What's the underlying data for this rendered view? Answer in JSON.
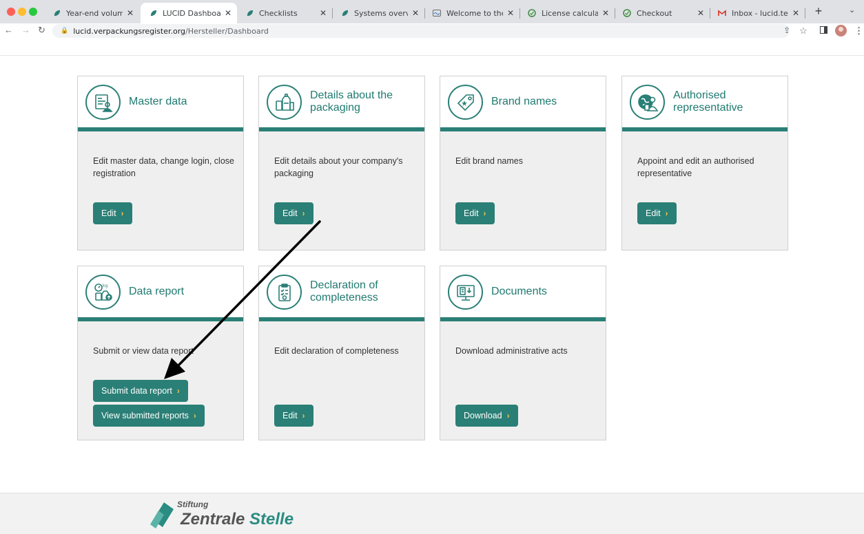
{
  "browser": {
    "tabs": [
      {
        "title": "Year-end volume repo",
        "favicon": "lucid-leaf-icon",
        "active": false
      },
      {
        "title": "LUCID Dashboard",
        "favicon": "lucid-leaf-icon",
        "active": true
      },
      {
        "title": "Checklists",
        "favicon": "lucid-leaf-icon",
        "active": false
      },
      {
        "title": "Systems overview",
        "favicon": "lucid-leaf-icon",
        "active": false
      },
      {
        "title": "Welcome to the Bella",
        "favicon": "wave-icon",
        "active": false
      },
      {
        "title": "License calculator",
        "favicon": "green-circle-icon",
        "active": false
      },
      {
        "title": "Checkout",
        "favicon": "green-circle-icon",
        "active": false
      },
      {
        "title": "Inbox - lucid.test.co@",
        "favicon": "gmail-icon",
        "active": false
      }
    ],
    "address": {
      "host": "lucid.verpackungsregister.org",
      "path": "/Hersteller/Dashboard"
    }
  },
  "cards": [
    {
      "title": "Master data",
      "description": "Edit master data, change login, close registration",
      "icon": "master-data-icon",
      "buttons": [
        "Edit"
      ]
    },
    {
      "title": "Details about the packaging",
      "description": "Edit details about your company's packaging",
      "icon": "packaging-icon",
      "buttons": [
        "Edit"
      ]
    },
    {
      "title": "Brand names",
      "description": "Edit brand names",
      "icon": "brand-tag-icon",
      "buttons": [
        "Edit"
      ]
    },
    {
      "title": "Authorised representative",
      "description": "Appoint and edit an authorised representative",
      "icon": "representative-globe-icon",
      "buttons": [
        "Edit"
      ]
    },
    {
      "title": "Data report",
      "description": "Submit or view data report",
      "icon": "data-report-scale-icon",
      "buttons": [
        "Submit data report",
        "View submitted reports"
      ]
    },
    {
      "title": "Declaration of completeness",
      "description": "Edit declaration of completeness",
      "icon": "declaration-clipboard-icon",
      "buttons": [
        "Edit"
      ]
    },
    {
      "title": "Documents",
      "description": "Download administrative acts",
      "icon": "documents-monitor-icon",
      "buttons": [
        "Download"
      ]
    }
  ],
  "footer": {
    "logo_small": "Stiftung",
    "logo_big_a": "Zentrale ",
    "logo_big_b": "Stelle"
  },
  "colors": {
    "accent": "#2a7f76",
    "chevron": "#f3c44b",
    "card_bg": "#efefef"
  }
}
